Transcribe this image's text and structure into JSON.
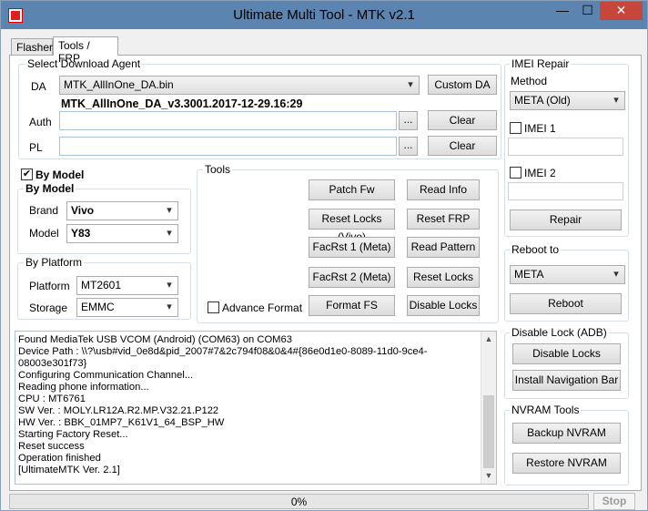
{
  "window": {
    "title": "Ultimate Multi Tool - MTK v2.1",
    "min": "—",
    "max": "☐",
    "close": "✕"
  },
  "tabs": [
    "Flasher",
    "Tools / FRP"
  ],
  "download_agent": {
    "title": "Select Download Agent",
    "da_label": "DA",
    "da_value": "MTK_AllInOne_DA.bin",
    "da_version": "MTK_AllInOne_DA_v3.3001.2017-12-29.16:29",
    "custom_da": "Custom DA",
    "auth_label": "Auth",
    "pl_label": "PL",
    "browse": "...",
    "clear": "Clear"
  },
  "by_model": {
    "checkbox_label": "By Model",
    "checked": true,
    "title": "By Model",
    "brand_label": "Brand",
    "brand_value": "Vivo",
    "model_label": "Model",
    "model_value": "Y83"
  },
  "by_platform": {
    "title": "By Platform",
    "platform_label": "Platform",
    "platform_value": "MT2601",
    "storage_label": "Storage",
    "storage_value": "EMMC"
  },
  "tools": {
    "title": "Tools",
    "patch_fw": "Patch Fw",
    "read_info": "Read Info",
    "reset_locks_vivo": "Reset Locks (Vivo)",
    "reset_frp": "Reset FRP",
    "facrst1": "FacRst 1 (Meta)",
    "read_pattern": "Read Pattern",
    "facrst2": "FacRst 2 (Meta)",
    "reset_locks": "Reset Locks",
    "advance_format": "Advance Format",
    "format_fs": "Format FS",
    "disable_locks": "Disable Locks"
  },
  "imei_repair": {
    "title": "IMEI Repair",
    "method_label": "Method",
    "method_value": "META (Old)",
    "imei1": "IMEI 1",
    "imei2": "IMEI 2",
    "repair": "Repair"
  },
  "reboot": {
    "title": "Reboot to",
    "value": "META",
    "button": "Reboot"
  },
  "disable_lock": {
    "title": "Disable Lock (ADB)",
    "disable_locks": "Disable Locks",
    "install_nav": "Install Navigation Bar"
  },
  "nvram": {
    "title": "NVRAM Tools",
    "backup": "Backup NVRAM",
    "restore": "Restore NVRAM"
  },
  "log": [
    "Found MediaTek USB VCOM (Android) (COM63) on COM63",
    "Device Path : \\\\?\\usb#vid_0e8d&pid_2007#7&2c794f08&0&4#{86e0d1e0-8089-11d0-9ce4-08003e301f73}",
    "Configuring Communication Channel...",
    "Reading phone information...",
    "CPU : MT6761",
    "SW Ver. : MOLY.LR12A.R2.MP.V32.21.P122",
    "HW Ver. : BBK_01MP7_K61V1_64_BSP_HW",
    "Starting Factory Reset...",
    "Reset success",
    "Operation finished",
    "[UltimateMTK Ver. 2.1]"
  ],
  "progress": {
    "text": "0%",
    "value": 0
  },
  "stop": "Stop"
}
